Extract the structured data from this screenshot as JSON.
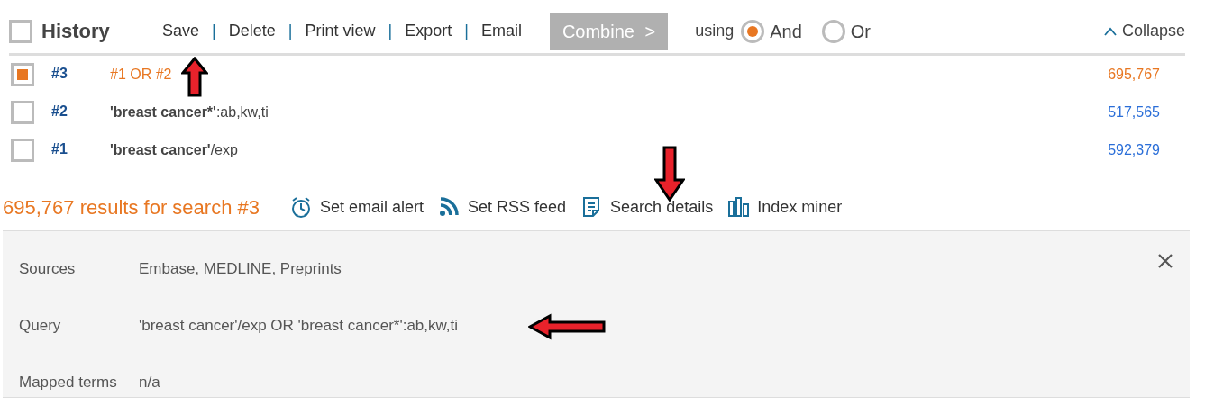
{
  "header": {
    "title": "History",
    "all_checked": false,
    "separator": "|",
    "actions": [
      {
        "label": "Save"
      },
      {
        "label": "Delete"
      },
      {
        "label": "Print view"
      },
      {
        "label": "Export"
      },
      {
        "label": "Email"
      }
    ],
    "combine": {
      "label": "Combine",
      "disabled": true,
      "arrow": ">"
    },
    "using_label": "using",
    "operators": [
      {
        "label": "And",
        "selected": true
      },
      {
        "label": "Or",
        "selected": false
      }
    ],
    "collapse": {
      "label": "Collapse"
    }
  },
  "history": [
    {
      "number": "#3",
      "checked": true,
      "selected": true,
      "query": [
        {
          "text": "#1 OR #2",
          "bold": false
        }
      ],
      "count": "695,767"
    },
    {
      "number": "#2",
      "checked": false,
      "selected": false,
      "query": [
        {
          "text": "'breast cancer*'",
          "bold": true
        },
        {
          "text": ":ab,kw,ti",
          "bold": false
        }
      ],
      "count": "517,565"
    },
    {
      "number": "#1",
      "checked": false,
      "selected": false,
      "query": [
        {
          "text": "'breast cancer'",
          "bold": true
        },
        {
          "text": "/exp",
          "bold": false
        }
      ],
      "count": "592,379"
    }
  ],
  "results": {
    "summary": "695,767 results for search #3",
    "tools": [
      {
        "kind": "alarm",
        "label": "Set email alert"
      },
      {
        "kind": "rss",
        "label": "Set RSS feed"
      },
      {
        "kind": "document",
        "label": "Search details"
      },
      {
        "kind": "bars",
        "label": "Index miner"
      }
    ]
  },
  "details": {
    "rows": [
      {
        "label": "Sources",
        "value": "Embase, MEDLINE, Preprints"
      },
      {
        "label": "Query",
        "value": "'breast cancer'/exp OR 'breast cancer*':ab,kw,ti"
      },
      {
        "label": "Mapped terms",
        "value": "n/a"
      }
    ]
  },
  "annotations": [
    {
      "kind": "arrow"
    },
    {
      "kind": "arrow"
    },
    {
      "kind": "arrow"
    }
  ]
}
